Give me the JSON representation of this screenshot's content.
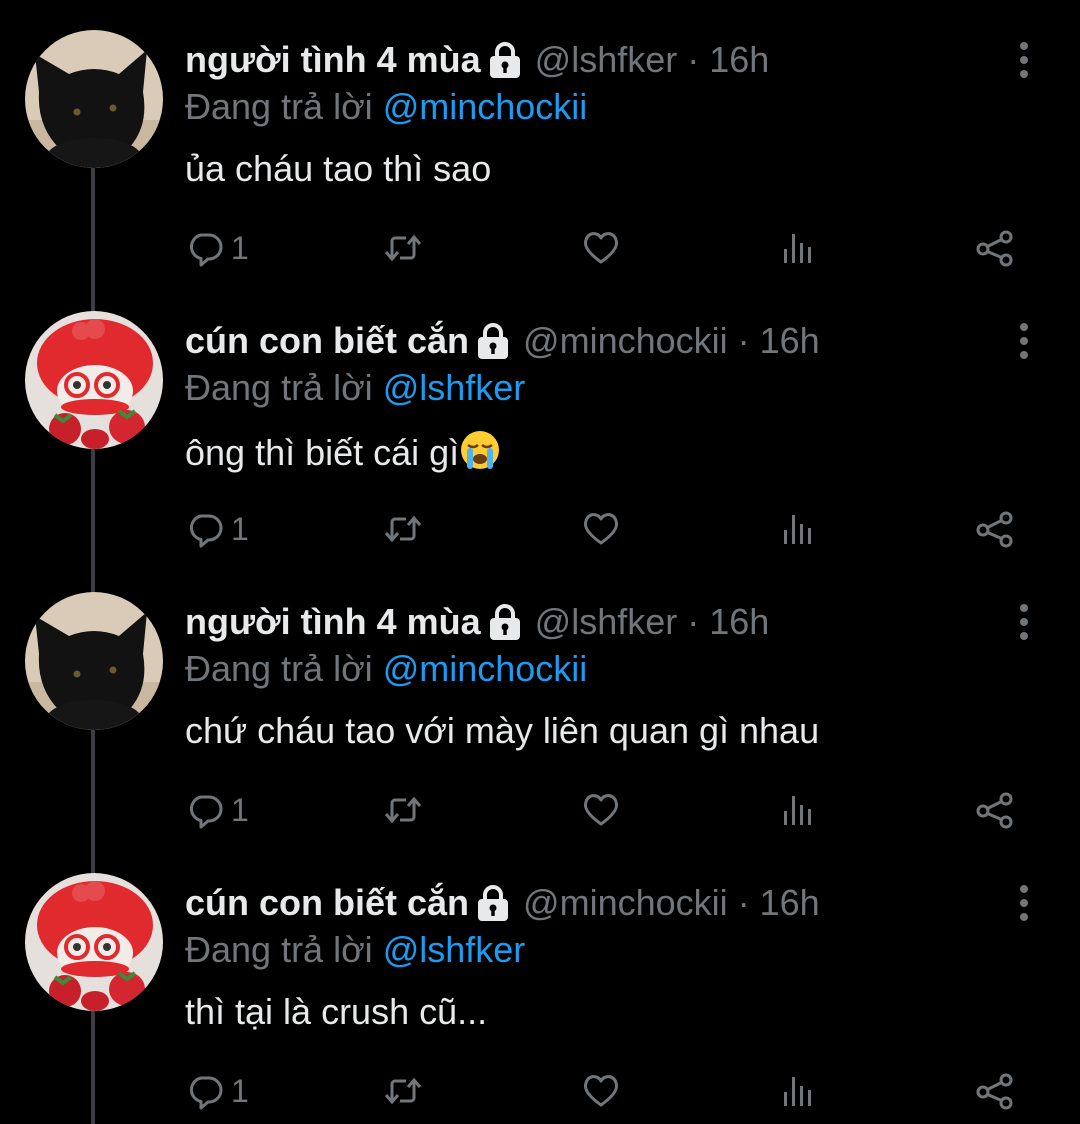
{
  "thread": [
    {
      "name": "người tình 4 mùa",
      "handle": "@lshfker",
      "separator": "·",
      "time": "16h",
      "reply_prefix": "Đang trả lời",
      "reply_to": "@minchockii",
      "text": "ủa cháu tao thì sao",
      "reply_count": "1",
      "avatar": "black-cat"
    },
    {
      "name": "cún con biết cắn",
      "handle": "@minchockii",
      "separator": "·",
      "time": "16h",
      "reply_prefix": "Đang trả lời",
      "reply_to": "@lshfker",
      "text": "ông thì biết cái gì",
      "reply_count": "1",
      "avatar": "red-hat-doll",
      "emoji": "loudly-crying-face"
    },
    {
      "name": "người tình 4 mùa",
      "handle": "@lshfker",
      "separator": "·",
      "time": "16h",
      "reply_prefix": "Đang trả lời",
      "reply_to": "@minchockii",
      "text": "chứ cháu tao với mày liên quan gì nhau",
      "reply_count": "1",
      "avatar": "black-cat"
    },
    {
      "name": "cún con biết cắn",
      "handle": "@minchockii",
      "separator": "·",
      "time": "16h",
      "reply_prefix": "Đang trả lời",
      "reply_to": "@lshfker",
      "text": "thì tại là crush cũ...",
      "reply_count": "1",
      "avatar": "red-hat-doll"
    }
  ],
  "colors": {
    "background": "#000000",
    "text": "#e7e9ea",
    "secondary": "#71767b",
    "link": "#1d9bf0",
    "thread_line": "#3a3d41"
  },
  "icons": [
    "lock-icon",
    "more-options-icon",
    "reply-icon",
    "retweet-icon",
    "like-icon",
    "views-icon",
    "share-icon"
  ]
}
